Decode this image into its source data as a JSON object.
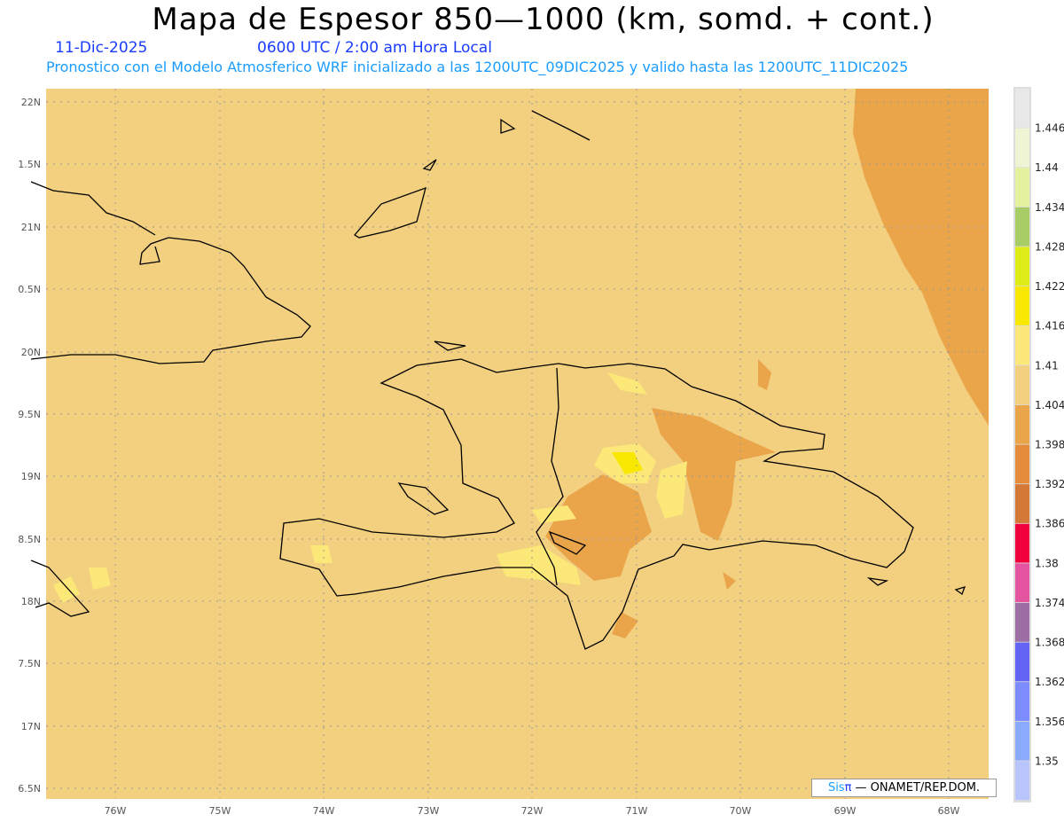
{
  "header": {
    "title": "Mapa de Espesor 850—1000 (km, somd. + cont.)",
    "date": "11-Dic-2025",
    "time": "0600 UTC / 2:00 am Hora Local",
    "subtitle": "Pronostico con el Modelo Atmosferico WRF inicializado a las 1200UTC_09DIC2025 y valido hasta las  1200UTC_11DIC2025"
  },
  "axes": {
    "lon_labels": [
      "76W",
      "75W",
      "74W",
      "73W",
      "72W",
      "71W",
      "70W",
      "69W",
      "68W"
    ],
    "lat_labels": [
      "22N",
      "1.5N",
      "21N",
      "0.5N",
      "20N",
      "9.5N",
      "19N",
      "8.5N",
      "18N",
      "7.5N",
      "17N",
      "6.5N"
    ]
  },
  "colorbar": {
    "labels": [
      "1.446",
      "1.44",
      "1.434",
      "1.428",
      "1.422",
      "1.416",
      "1.41",
      "1.404",
      "1.398",
      "1.392",
      "1.386",
      "1.38",
      "1.374",
      "1.368",
      "1.362",
      "1.356",
      "1.35"
    ],
    "colors": [
      "#e8e8e8",
      "#eef4d4",
      "#e4f2a0",
      "#a8cc66",
      "#e0ec18",
      "#f8e800",
      "#fce878",
      "#f2d080",
      "#eaa54a",
      "#e48c3c",
      "#d47838",
      "#f0003c",
      "#e454a0",
      "#9c6ea4",
      "#6464f4",
      "#7c8cfc",
      "#8caafc",
      "#b8c4fc"
    ]
  },
  "credit": {
    "brand": "Sis",
    "pi": "π",
    "rest": " —  ONAMET/REP.DOM."
  }
}
